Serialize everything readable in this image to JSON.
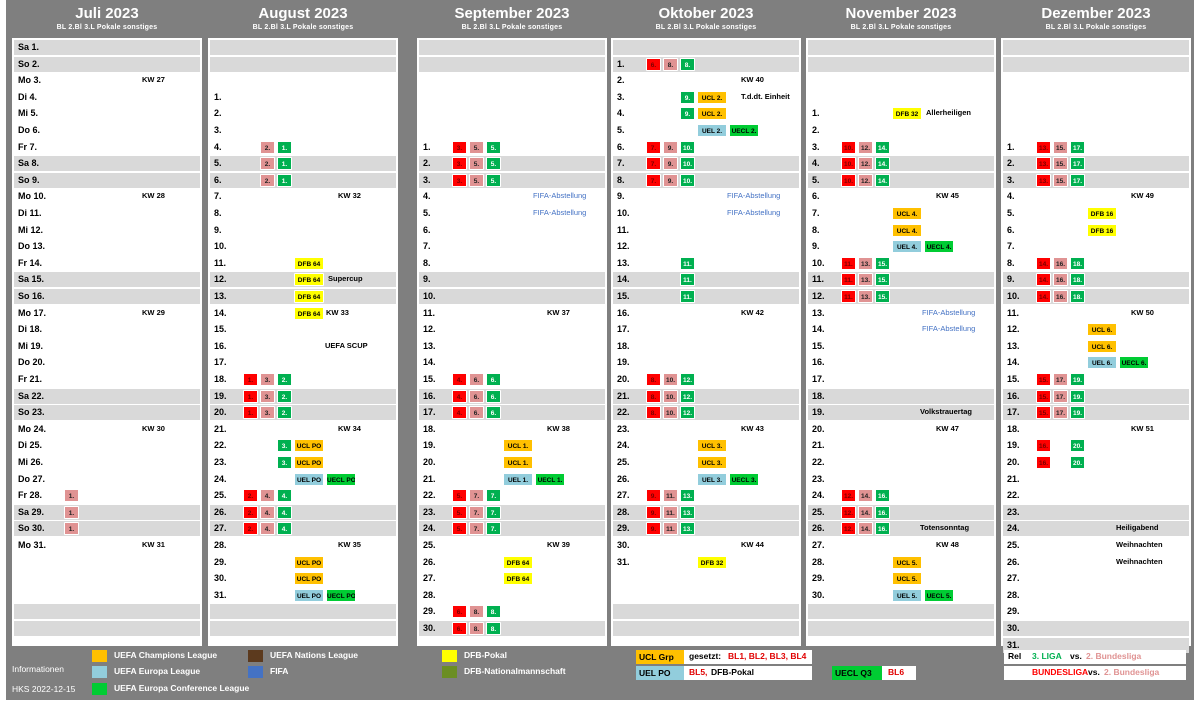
{
  "header_cols": "BL  2.Bl  3.L  Pokale  sonstiges",
  "months": [
    {
      "title": "Juli 2023",
      "rows": [
        {
          "dt": "Sa  1.",
          "g": 1
        },
        {
          "dt": "So  2.",
          "g": 1
        },
        {
          "dt": "Mo  3.",
          "kw": "KW 27"
        },
        {
          "dt": "Di  4."
        },
        {
          "dt": "Mi  5."
        },
        {
          "dt": "Do  6."
        },
        {
          "dt": "Fr  7."
        },
        {
          "dt": "Sa  8.",
          "g": 1
        },
        {
          "dt": "So  9.",
          "g": 1
        },
        {
          "dt": "Mo  10.",
          "kw": "KW 28"
        },
        {
          "dt": "Di  11."
        },
        {
          "dt": "Mi  12."
        },
        {
          "dt": "Do  13."
        },
        {
          "dt": "Fr  14."
        },
        {
          "dt": "Sa  15.",
          "g": 1
        },
        {
          "dt": "So  16.",
          "g": 1
        },
        {
          "dt": "Mo  17.",
          "kw": "KW 29"
        },
        {
          "dt": "Di  18."
        },
        {
          "dt": "Mi  19."
        },
        {
          "dt": "Do  20."
        },
        {
          "dt": "Fr  21."
        },
        {
          "dt": "Sa  22.",
          "g": 1
        },
        {
          "dt": "So  23.",
          "g": 1
        },
        {
          "dt": "Mo  24.",
          "kw": "KW 30"
        },
        {
          "dt": "Di  25."
        },
        {
          "dt": "Mi  26."
        },
        {
          "dt": "Do  27."
        },
        {
          "dt": "Fr  28.",
          "b2": "1."
        },
        {
          "dt": "Sa  29.",
          "g": 1,
          "b2": "1."
        },
        {
          "dt": "So  30.",
          "g": 1,
          "b2": "1."
        },
        {
          "dt": "Mo  31.",
          "kw": "KW 31"
        },
        {
          "dt": ""
        },
        {
          "dt": ""
        },
        {
          "dt": ""
        },
        {
          "dt": "",
          "g": 1
        },
        {
          "dt": "",
          "g": 1
        }
      ]
    },
    {
      "title": "August 2023",
      "rows": [
        {
          "dt": "",
          "g": 1
        },
        {
          "dt": "",
          "g": 1
        },
        {
          "dt": ""
        },
        {
          "dt": "1."
        },
        {
          "dt": "2."
        },
        {
          "dt": "3."
        },
        {
          "dt": "4.",
          "b2": "2.",
          "b3": "1."
        },
        {
          "dt": "5.",
          "g": 1,
          "b2": "2.",
          "b3": "1."
        },
        {
          "dt": "6.",
          "g": 1,
          "b2": "2.",
          "b3": "1."
        },
        {
          "dt": "7.",
          "kw": "KW 32"
        },
        {
          "dt": "8."
        },
        {
          "dt": "9."
        },
        {
          "dt": "10."
        },
        {
          "dt": "11.",
          "p": "DFB 64",
          "pc": "dfb"
        },
        {
          "dt": "12.",
          "g": 1,
          "p": "DFB 64",
          "pc": "dfb",
          "note": "Supercup"
        },
        {
          "dt": "13.",
          "g": 1,
          "p": "DFB 64",
          "pc": "dfb"
        },
        {
          "dt": "14.",
          "p": "DFB 64",
          "pc": "dfb",
          "kw": "KW 33",
          "kwleft": 1
        },
        {
          "dt": "15."
        },
        {
          "dt": "16.",
          "note": "UEFA SCUP",
          "noteX": 115
        },
        {
          "dt": "17."
        },
        {
          "dt": "18.",
          "b1": "1.",
          "b2": "3.",
          "b3": "2."
        },
        {
          "dt": "19.",
          "g": 1,
          "b1": "1.",
          "b2": "3.",
          "b3": "2."
        },
        {
          "dt": "20.",
          "g": 1,
          "b1": "1.",
          "b2": "3.",
          "b3": "2."
        },
        {
          "dt": "21.",
          "kw": "KW 34"
        },
        {
          "dt": "22.",
          "b3": "3.",
          "p": "UCL PO",
          "pc": "ucl"
        },
        {
          "dt": "23.",
          "b3": "3.",
          "p": "UCL PO",
          "pc": "ucl"
        },
        {
          "dt": "24.",
          "p": "UEL PO",
          "pc": "uel",
          "p2": "UECL PO"
        },
        {
          "dt": "25.",
          "b1": "2.",
          "b2": "4.",
          "b3": "4."
        },
        {
          "dt": "26.",
          "g": 1,
          "b1": "2.",
          "b2": "4.",
          "b3": "4."
        },
        {
          "dt": "27.",
          "g": 1,
          "b1": "2.",
          "b2": "4.",
          "b3": "4."
        },
        {
          "dt": "28.",
          "kw": "KW 35"
        },
        {
          "dt": "29.",
          "p": "UCL PO",
          "pc": "ucl"
        },
        {
          "dt": "30.",
          "p": "UCL PO",
          "pc": "ucl"
        },
        {
          "dt": "31.",
          "p": "UEL PO",
          "pc": "uel",
          "p2": "UECL PO"
        },
        {
          "dt": "",
          "g": 1
        },
        {
          "dt": "",
          "g": 1
        }
      ]
    },
    {
      "title": "September 2023",
      "rows": [
        {
          "dt": "",
          "g": 1
        },
        {
          "dt": "",
          "g": 1
        },
        {
          "dt": ""
        },
        {
          "dt": ""
        },
        {
          "dt": ""
        },
        {
          "dt": ""
        },
        {
          "dt": "1.",
          "b1": "3.",
          "b2": "5.",
          "b3": "5."
        },
        {
          "dt": "2.",
          "g": 1,
          "b1": "3.",
          "b2": "5.",
          "b3": "5."
        },
        {
          "dt": "3.",
          "g": 1,
          "b1": "3.",
          "b2": "5.",
          "b3": "5."
        },
        {
          "dt": "4.",
          "fifa": "FIFA-Abstellung"
        },
        {
          "dt": "5.",
          "fifa": "FIFA-Abstellung"
        },
        {
          "dt": "6."
        },
        {
          "dt": "7."
        },
        {
          "dt": "8."
        },
        {
          "dt": "9.",
          "g": 1
        },
        {
          "dt": "10.",
          "g": 1
        },
        {
          "dt": "11.",
          "kw": "KW 37"
        },
        {
          "dt": "12."
        },
        {
          "dt": "13."
        },
        {
          "dt": "14."
        },
        {
          "dt": "15.",
          "b1": "4.",
          "b2": "6.",
          "b3": "6."
        },
        {
          "dt": "16.",
          "g": 1,
          "b1": "4.",
          "b2": "6.",
          "b3": "6."
        },
        {
          "dt": "17.",
          "g": 1,
          "b1": "4.",
          "b2": "6.",
          "b3": "6."
        },
        {
          "dt": "18.",
          "kw": "KW 38"
        },
        {
          "dt": "19.",
          "p": "UCL 1.",
          "pc": "ucl"
        },
        {
          "dt": "20.",
          "p": "UCL 1.",
          "pc": "ucl"
        },
        {
          "dt": "21.",
          "p": "UEL 1.",
          "pc": "uel",
          "p2": "UECL 1."
        },
        {
          "dt": "22.",
          "b1": "5.",
          "b2": "7.",
          "b3": "7."
        },
        {
          "dt": "23.",
          "g": 1,
          "b1": "5.",
          "b2": "7.",
          "b3": "7."
        },
        {
          "dt": "24.",
          "g": 1,
          "b1": "5.",
          "b2": "7.",
          "b3": "7."
        },
        {
          "dt": "25.",
          "kw": "KW 39"
        },
        {
          "dt": "26.",
          "p": "DFB 64",
          "pc": "dfb"
        },
        {
          "dt": "27.",
          "p": "DFB 64",
          "pc": "dfb"
        },
        {
          "dt": "28."
        },
        {
          "dt": "29.",
          "b1": "6.",
          "b2": "8.",
          "b3": "8."
        },
        {
          "dt": "30.",
          "g": 1,
          "b1": "6.",
          "b2": "8.",
          "b3": "8."
        }
      ]
    },
    {
      "title": "Oktober 2023",
      "rows": [
        {
          "dt": "",
          "g": 1
        },
        {
          "dt": "1.",
          "g": 1,
          "b1": "6.",
          "b2": "8.",
          "b3": "8."
        },
        {
          "dt": "2.",
          "kw": "KW 40"
        },
        {
          "dt": "3.",
          "b3": "9.",
          "p": "UCL 2.",
          "pc": "ucl",
          "note": "T.d.dt. Einheit",
          "noteX": 128
        },
        {
          "dt": "4.",
          "b3": "9.",
          "p": "UCL 2.",
          "pc": "ucl"
        },
        {
          "dt": "5.",
          "p": "UEL 2.",
          "pc": "uel",
          "p2": "UECL 2."
        },
        {
          "dt": "6.",
          "b1": "7.",
          "b2": "9.",
          "b3": "10."
        },
        {
          "dt": "7.",
          "g": 1,
          "b1": "7.",
          "b2": "9.",
          "b3": "10."
        },
        {
          "dt": "8.",
          "g": 1,
          "b1": "7.",
          "b2": "9.",
          "b3": "10."
        },
        {
          "dt": "9.",
          "fifa": "FIFA-Abstellung"
        },
        {
          "dt": "10.",
          "fifa": "FIFA-Abstellung"
        },
        {
          "dt": "11."
        },
        {
          "dt": "12."
        },
        {
          "dt": "13.",
          "b3": "11."
        },
        {
          "dt": "14.",
          "g": 1,
          "b3": "11."
        },
        {
          "dt": "15.",
          "g": 1,
          "b3": "11."
        },
        {
          "dt": "16.",
          "kw": "KW 42"
        },
        {
          "dt": "17."
        },
        {
          "dt": "18."
        },
        {
          "dt": "19."
        },
        {
          "dt": "20.",
          "b1": "8.",
          "b2": "10.",
          "b3": "12."
        },
        {
          "dt": "21.",
          "g": 1,
          "b1": "8.",
          "b2": "10.",
          "b3": "12."
        },
        {
          "dt": "22.",
          "g": 1,
          "b1": "8.",
          "b2": "10.",
          "b3": "12."
        },
        {
          "dt": "23.",
          "kw": "KW 43"
        },
        {
          "dt": "24.",
          "p": "UCL 3.",
          "pc": "ucl"
        },
        {
          "dt": "25.",
          "p": "UCL 3.",
          "pc": "ucl"
        },
        {
          "dt": "26.",
          "p": "UEL 3.",
          "pc": "uel",
          "p2": "UECL 3."
        },
        {
          "dt": "27.",
          "b1": "9.",
          "b2": "11.",
          "b3": "13."
        },
        {
          "dt": "28.",
          "g": 1,
          "b1": "9.",
          "b2": "11.",
          "b3": "13."
        },
        {
          "dt": "29.",
          "g": 1,
          "b1": "9.",
          "b2": "11.",
          "b3": "13."
        },
        {
          "dt": "30.",
          "kw": "KW 44"
        },
        {
          "dt": "31.",
          "p": "DFB 32",
          "pc": "dfb"
        },
        {
          "dt": ""
        },
        {
          "dt": ""
        },
        {
          "dt": "",
          "g": 1
        },
        {
          "dt": "",
          "g": 1
        }
      ]
    },
    {
      "title": "November 2023",
      "rows": [
        {
          "dt": "",
          "g": 1
        },
        {
          "dt": "",
          "g": 1
        },
        {
          "dt": ""
        },
        {
          "dt": ""
        },
        {
          "dt": "1.",
          "p": "DFB 32",
          "pc": "dfb",
          "note": "Allerheiligen",
          "noteX": 118
        },
        {
          "dt": "2."
        },
        {
          "dt": "3.",
          "b1": "10.",
          "b2": "12.",
          "b3": "14."
        },
        {
          "dt": "4.",
          "g": 1,
          "b1": "10.",
          "b2": "12.",
          "b3": "14."
        },
        {
          "dt": "5.",
          "g": 1,
          "b1": "10.",
          "b2": "12.",
          "b3": "14."
        },
        {
          "dt": "6.",
          "kw": "KW 45"
        },
        {
          "dt": "7.",
          "p": "UCL 4.",
          "pc": "ucl"
        },
        {
          "dt": "8.",
          "p": "UCL 4.",
          "pc": "ucl"
        },
        {
          "dt": "9.",
          "p": "UEL 4.",
          "pc": "uel",
          "p2": "UECL 4."
        },
        {
          "dt": "10.",
          "b1": "11.",
          "b2": "13.",
          "b3": "15."
        },
        {
          "dt": "11.",
          "g": 1,
          "b1": "11.",
          "b2": "13.",
          "b3": "15."
        },
        {
          "dt": "12.",
          "g": 1,
          "b1": "11.",
          "b2": "13.",
          "b3": "15."
        },
        {
          "dt": "13.",
          "fifa": "FIFA-Abstellung"
        },
        {
          "dt": "14.",
          "fifa": "FIFA-Abstellung"
        },
        {
          "dt": "15."
        },
        {
          "dt": "16."
        },
        {
          "dt": "17."
        },
        {
          "dt": "18.",
          "g": 1
        },
        {
          "dt": "19.",
          "g": 1,
          "note": "Volkstrauertag",
          "noteX": 112
        },
        {
          "dt": "20.",
          "kw": "KW 47"
        },
        {
          "dt": "21."
        },
        {
          "dt": "22."
        },
        {
          "dt": "23."
        },
        {
          "dt": "24.",
          "b1": "12.",
          "b2": "14.",
          "b3": "16."
        },
        {
          "dt": "25.",
          "g": 1,
          "b1": "12.",
          "b2": "14.",
          "b3": "16."
        },
        {
          "dt": "26.",
          "g": 1,
          "b1": "12.",
          "b2": "14.",
          "b3": "16.",
          "note": "Totensonntag",
          "noteX": 112
        },
        {
          "dt": "27.",
          "kw": "KW 48"
        },
        {
          "dt": "28.",
          "p": "UCL 5.",
          "pc": "ucl"
        },
        {
          "dt": "29.",
          "p": "UCL 5.",
          "pc": "ucl"
        },
        {
          "dt": "30.",
          "p": "UEL 5.",
          "pc": "uel",
          "p2": "UECL 5."
        },
        {
          "dt": "",
          "g": 1
        },
        {
          "dt": "",
          "g": 1
        }
      ]
    },
    {
      "title": "Dezember 2023",
      "rows": [
        {
          "dt": "",
          "g": 1
        },
        {
          "dt": "",
          "g": 1
        },
        {
          "dt": ""
        },
        {
          "dt": ""
        },
        {
          "dt": ""
        },
        {
          "dt": ""
        },
        {
          "dt": "1.",
          "b1": "13.",
          "b2": "15.",
          "b3": "17."
        },
        {
          "dt": "2.",
          "g": 1,
          "b1": "13.",
          "b2": "15.",
          "b3": "17."
        },
        {
          "dt": "3.",
          "g": 1,
          "b1": "13.",
          "b2": "15.",
          "b3": "17."
        },
        {
          "dt": "4.",
          "kw": "KW 49"
        },
        {
          "dt": "5.",
          "p": "DFB 16",
          "pc": "dfb"
        },
        {
          "dt": "6.",
          "p": "DFB 16",
          "pc": "dfb"
        },
        {
          "dt": "7."
        },
        {
          "dt": "8.",
          "b1": "14.",
          "b2": "16.",
          "b3": "18."
        },
        {
          "dt": "9.",
          "g": 1,
          "b1": "14.",
          "b2": "16.",
          "b3": "18."
        },
        {
          "dt": "10.",
          "g": 1,
          "b1": "14.",
          "b2": "16.",
          "b3": "18."
        },
        {
          "dt": "11.",
          "kw": "KW 50"
        },
        {
          "dt": "12.",
          "p": "UCL 6.",
          "pc": "ucl"
        },
        {
          "dt": "13.",
          "p": "UCL 6.",
          "pc": "ucl"
        },
        {
          "dt": "14.",
          "p": "UEL 6.",
          "pc": "uel",
          "p2": "UECL 6."
        },
        {
          "dt": "15.",
          "b1": "15.",
          "b2": "17.",
          "b3": "19."
        },
        {
          "dt": "16.",
          "g": 1,
          "b1": "15.",
          "b2": "17.",
          "b3": "19."
        },
        {
          "dt": "17.",
          "g": 1,
          "b1": "15.",
          "b2": "17.",
          "b3": "19."
        },
        {
          "dt": "18.",
          "kw": "KW 51"
        },
        {
          "dt": "19.",
          "b1": "16.",
          "b3": "20."
        },
        {
          "dt": "20.",
          "b1": "16.",
          "b3": "20."
        },
        {
          "dt": "21."
        },
        {
          "dt": "22."
        },
        {
          "dt": "23.",
          "g": 1
        },
        {
          "dt": "24.",
          "g": 1,
          "note": "Heiligabend",
          "noteX": 113
        },
        {
          "dt": "25.",
          "note": "Weihnachten",
          "noteX": 113
        },
        {
          "dt": "26.",
          "note": "Weihnachten",
          "noteX": 113
        },
        {
          "dt": "27."
        },
        {
          "dt": "28."
        },
        {
          "dt": "29."
        },
        {
          "dt": "30.",
          "g": 1
        },
        {
          "dt": "31.",
          "g": 1
        }
      ]
    }
  ],
  "legend": {
    "info": "Informationen",
    "version": "HKS 2022-12-15",
    "ucl": "UEFA Champions League",
    "uel": "UEFA Europa League",
    "uecl": "UEFA Europa Conference League",
    "unl": "UEFA Nations League",
    "fifa": "FIFA",
    "dfb": "DFB-Pokal",
    "nat": "DFB-Nationalmannschaft",
    "ucl_grp": "UCL Grp",
    "gesetzt_label": "gesetzt:",
    "gesetzt_val": "BL1, BL2, BL3, BL4",
    "uel_po": "UEL PO",
    "bl5": "BL5,",
    "dfb_pokal": "DFB-Pokal",
    "uecl_q3": "UECL Q3",
    "bl6": "BL6",
    "rel": "Rel",
    "liga3": "3. LIGA",
    "vs1": "vs.",
    "bundes2": "2. Bundesliga",
    "bundesliga": "BUNDESLIGA",
    "vs2": "vs.",
    "bundes2b": "2. Bundesliga"
  },
  "colors": {
    "bl1": "#ff0000",
    "bl2": "#e09393",
    "bl3": "#00b050",
    "ucl": "#ffc000",
    "uel": "#92cddc",
    "uecl": "#00cc33",
    "dfb": "#ffff00",
    "unl": "#5c3a1e",
    "fifa": "#4472c4",
    "nat": "#6b8e23"
  }
}
